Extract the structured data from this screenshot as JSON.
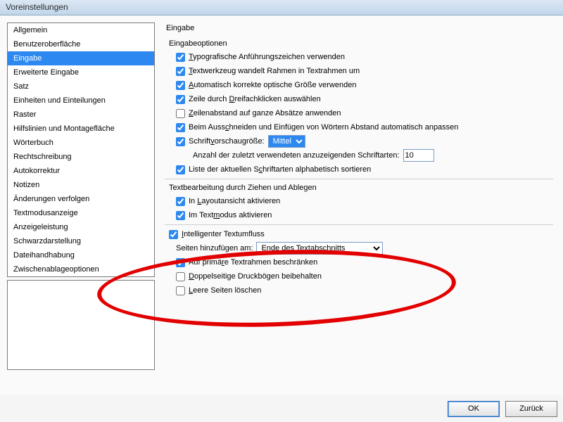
{
  "title": "Voreinstellungen",
  "sidebar": {
    "items": [
      "Allgemein",
      "Benutzeroberfläche",
      "Eingabe",
      "Erweiterte Eingabe",
      "Satz",
      "Einheiten und Einteilungen",
      "Raster",
      "Hilfslinien und Montagefläche",
      "Wörterbuch",
      "Rechtschreibung",
      "Autokorrektur",
      "Notizen",
      "Änderungen verfolgen",
      "Textmodusanzeige",
      "Anzeigeleistung",
      "Schwarzdarstellung",
      "Dateihandhabung",
      "Zwischenablageoptionen"
    ],
    "selectedIndex": 2
  },
  "content": {
    "heading": "Eingabe",
    "group1_label": "Eingabeoptionen",
    "typographic": "ypografische Anführungszeichen verwenden",
    "texttool": "extwerkzeug wandelt Rahmen in Textrahmen um",
    "autoOptical": "utomatisch korrekte optische Größe verwenden",
    "tripleClick": "Zeile durch ",
    "tripleClick2": "reifachklicken auswählen",
    "leading": "eilenabstand auf ganze Absätze anwenden",
    "cutPaste": "Beim Auss",
    "cutPaste2": "hneiden und Einfügen von Wörtern Abstand automatisch anpassen",
    "previewLabel": "Schrift",
    "previewLabel2": "orschaugröße:",
    "previewValue": "Mittel",
    "recentLabel": "Anzahl der zuletzt verwendeten anzuzeigenden Schriftarten:",
    "recentValue": "10",
    "sortFonts": "Liste der aktuellen S",
    "sortFonts2": "hriftarten alphabetisch sortieren",
    "group2_label": "Textbearbeitung durch Ziehen und Ablegen",
    "dragLayout": "In ",
    "dragLayout2": "ayoutansicht aktivieren",
    "dragStory": "Im Text",
    "dragStory2": "odus aktivieren",
    "smartReflow": "ntelligenter Textumfluss",
    "addPagesLabel": "Seiten hinzufügen am:",
    "addPagesValue": "Ende des Textabschnitts",
    "limitPrimary": "Auf primä",
    "limitPrimary2": "e Textrahmen beschränken",
    "keepSpreads": "oppelseitige Druckbögen beibehalten",
    "deleteEmpty": "eere Seiten löschen"
  },
  "buttons": {
    "ok": "OK",
    "back": "Zurück"
  }
}
